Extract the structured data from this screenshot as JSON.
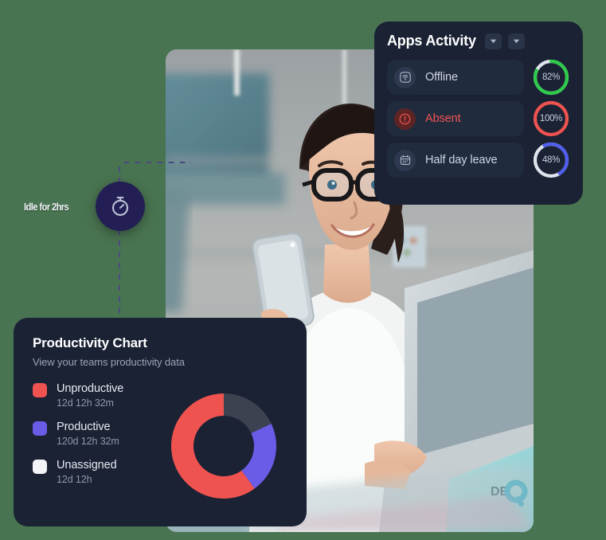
{
  "background_color": "#497451",
  "idle_marker": {
    "label": "Idle for 2hrs",
    "icon": "stopwatch-icon",
    "badge_color": "#231f54",
    "connector_color": "#4b4b80"
  },
  "photo": {
    "alt": "Woman with glasses holding a smartphone while working at a laptop in an office"
  },
  "apps_activity": {
    "title": "Apps Activity",
    "card_color": "#1a2234",
    "controls": [
      {
        "name": "sort-dropdown",
        "icon": "chevron-down-icon"
      },
      {
        "name": "filter-dropdown",
        "icon": "chevron-down-icon"
      }
    ],
    "rows": [
      {
        "label": "Offline",
        "icon": "wifi-off-icon",
        "icon_style": "neutral",
        "label_style": "neutral",
        "percent": 82,
        "percent_label": "82%",
        "ring_color": "#2ecc4a",
        "track_color": "#dfe5ec"
      },
      {
        "label": "Absent",
        "icon": "alert-circle-icon",
        "icon_style": "danger",
        "label_style": "danger",
        "percent": 100,
        "percent_label": "100%",
        "ring_color": "#ef5350",
        "track_color": "#ef5350"
      },
      {
        "label": "Half day leave",
        "icon": "calendar-icon",
        "icon_style": "neutral",
        "label_style": "neutral",
        "percent": 48,
        "percent_label": "48%",
        "ring_color": "#4f5ef0",
        "track_color": "#dfe5ec"
      }
    ]
  },
  "productivity": {
    "title": "Productivity Chart",
    "subtitle": "View your teams productivity data",
    "card_color": "#1a2234"
  },
  "chart_data": {
    "type": "pie",
    "title": "Productivity Chart",
    "subtitle": "View your teams productivity data",
    "donut": true,
    "legend_position": "left",
    "categories": [
      "Unproductive",
      "Productive",
      "Unassigned"
    ],
    "value_labels": [
      "12d 12h 32m",
      "120d 12h 32m",
      "12d 12h"
    ],
    "values": [
      60,
      22,
      18
    ],
    "colors": [
      "#ef5350",
      "#6b5ce7",
      "#3c4250"
    ],
    "slices": [
      {
        "name": "Unproductive",
        "value": 60,
        "value_label": "12d 12h 32m",
        "color": "#ef5350"
      },
      {
        "name": "Productive",
        "value": 22,
        "value_label": "120d 12h 32m",
        "color": "#6b5ce7"
      },
      {
        "name": "Unassigned",
        "value": 18,
        "value_label": "12d 12h",
        "color": "#3c4250"
      }
    ],
    "legend_swatch_colors": [
      "#ef5350",
      "#6b5ce7",
      "#f2f4f7"
    ]
  }
}
